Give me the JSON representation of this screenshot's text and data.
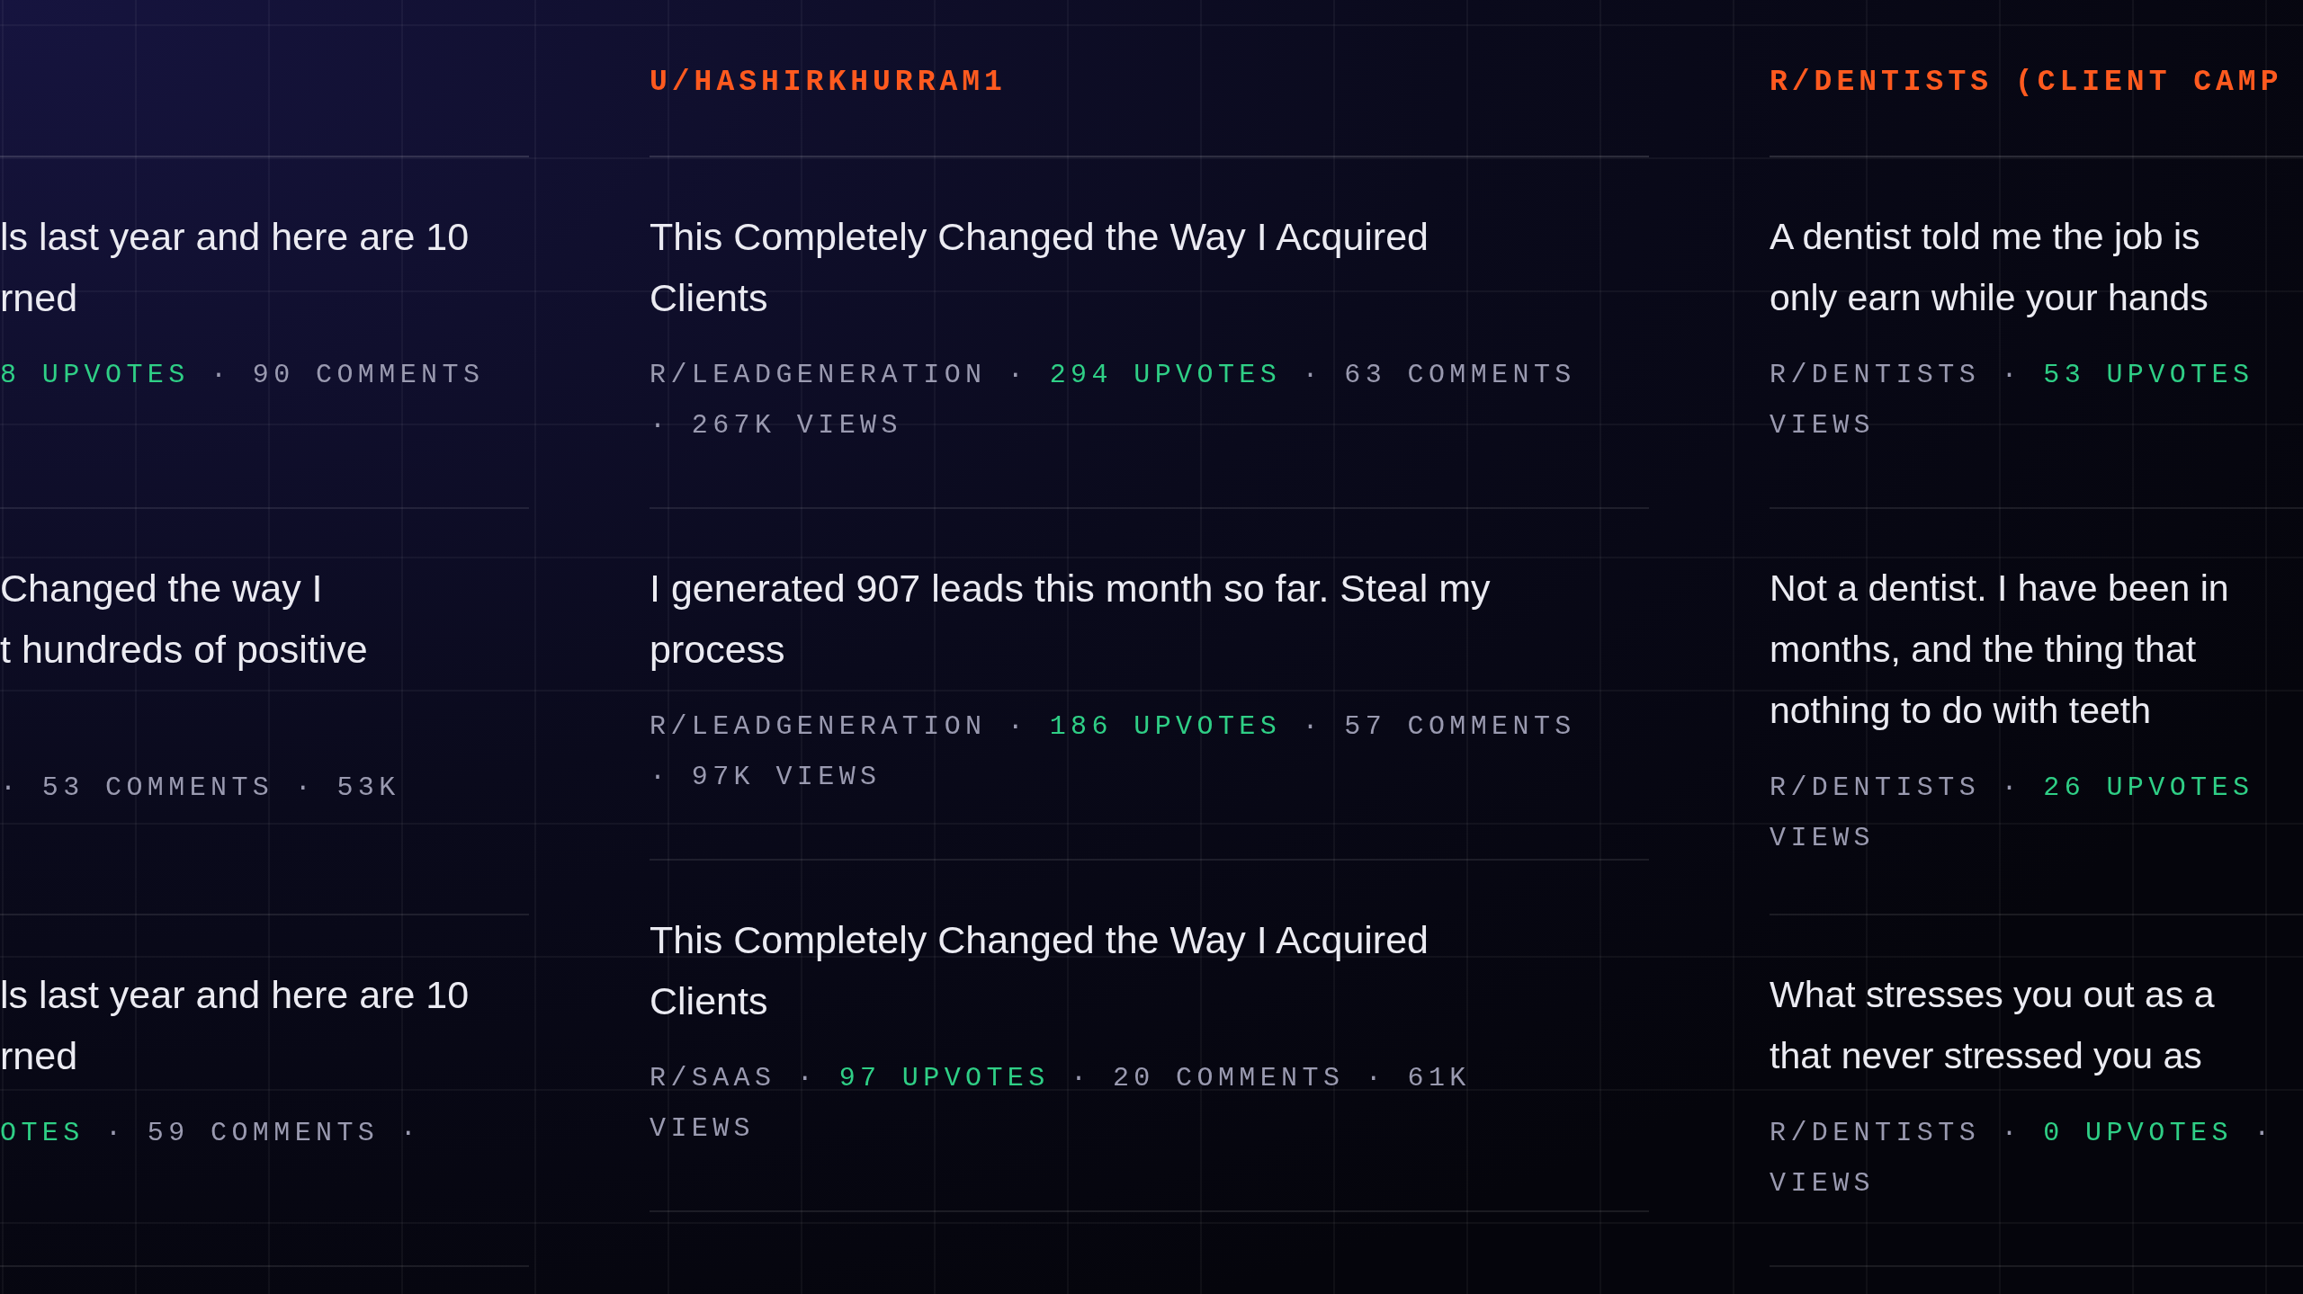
{
  "columns": [
    {
      "posts": [
        {
          "title": [
            "ls last year and here are 10",
            "rned"
          ],
          "meta": [
            [
              {
                "kind": "upvotes",
                "text": "8 UPVOTES"
              },
              {
                "kind": "plain",
                "text": " · 90 COMMENTS"
              }
            ]
          ]
        },
        {
          "title": [
            "Changed the way I",
            "t hundreds of positive"
          ],
          "meta": [
            [
              {
                "kind": "plain",
                "text": "· 53 COMMENTS · 53K"
              }
            ]
          ]
        },
        {
          "title": [
            "ls last year and here are 10",
            "rned"
          ],
          "meta": [
            [
              {
                "kind": "upvotes",
                "text": "OTES"
              },
              {
                "kind": "plain",
                "text": " · 59 COMMENTS ·"
              }
            ]
          ]
        }
      ]
    },
    {
      "header": "U/HASHIRKHURRAM1",
      "posts": [
        {
          "title": [
            "This Completely Changed the Way I Acquired",
            "Clients"
          ],
          "meta": [
            [
              {
                "kind": "plain",
                "text": "R/LEADGENERATION · "
              },
              {
                "kind": "upvotes",
                "text": "294 UPVOTES"
              },
              {
                "kind": "plain",
                "text": " · 63 COMMENTS"
              }
            ],
            [
              {
                "kind": "plain",
                "text": "· 267K VIEWS"
              }
            ]
          ]
        },
        {
          "title": [
            "I generated 907 leads this month so far. Steal my",
            "process"
          ],
          "meta": [
            [
              {
                "kind": "plain",
                "text": "R/LEADGENERATION · "
              },
              {
                "kind": "upvotes",
                "text": "186 UPVOTES"
              },
              {
                "kind": "plain",
                "text": " · 57 COMMENTS"
              }
            ],
            [
              {
                "kind": "plain",
                "text": "· 97K VIEWS"
              }
            ]
          ]
        },
        {
          "title": [
            "This Completely Changed the Way I Acquired",
            "Clients"
          ],
          "meta": [
            [
              {
                "kind": "plain",
                "text": "R/SAAS · "
              },
              {
                "kind": "upvotes",
                "text": "97 UPVOTES"
              },
              {
                "kind": "plain",
                "text": " · 20 COMMENTS · 61K"
              }
            ],
            [
              {
                "kind": "plain",
                "text": "VIEWS"
              }
            ]
          ]
        }
      ]
    },
    {
      "header": "R/DENTISTS (CLIENT CAMP",
      "posts": [
        {
          "title": [
            "A dentist told me the job is",
            "only earn while your hands"
          ],
          "meta": [
            [
              {
                "kind": "plain",
                "text": "R/DENTISTS · "
              },
              {
                "kind": "upvotes",
                "text": "53 UPVOTES"
              }
            ],
            [
              {
                "kind": "plain",
                "text": "VIEWS"
              }
            ]
          ]
        },
        {
          "title": [
            "Not a dentist. I have been in",
            "months, and the thing that",
            "nothing to do with teeth"
          ],
          "meta": [
            [
              {
                "kind": "plain",
                "text": "R/DENTISTS · "
              },
              {
                "kind": "upvotes",
                "text": "26 UPVOTES"
              }
            ],
            [
              {
                "kind": "plain",
                "text": "VIEWS"
              }
            ]
          ]
        },
        {
          "title": [
            "What stresses you out as a",
            "that never stressed you as"
          ],
          "meta": [
            [
              {
                "kind": "plain",
                "text": "R/DENTISTS · "
              },
              {
                "kind": "upvotes",
                "text": "0 UPVOTES"
              },
              {
                "kind": "plain",
                "text": " ·"
              }
            ],
            [
              {
                "kind": "plain",
                "text": "VIEWS"
              }
            ]
          ]
        }
      ]
    }
  ]
}
